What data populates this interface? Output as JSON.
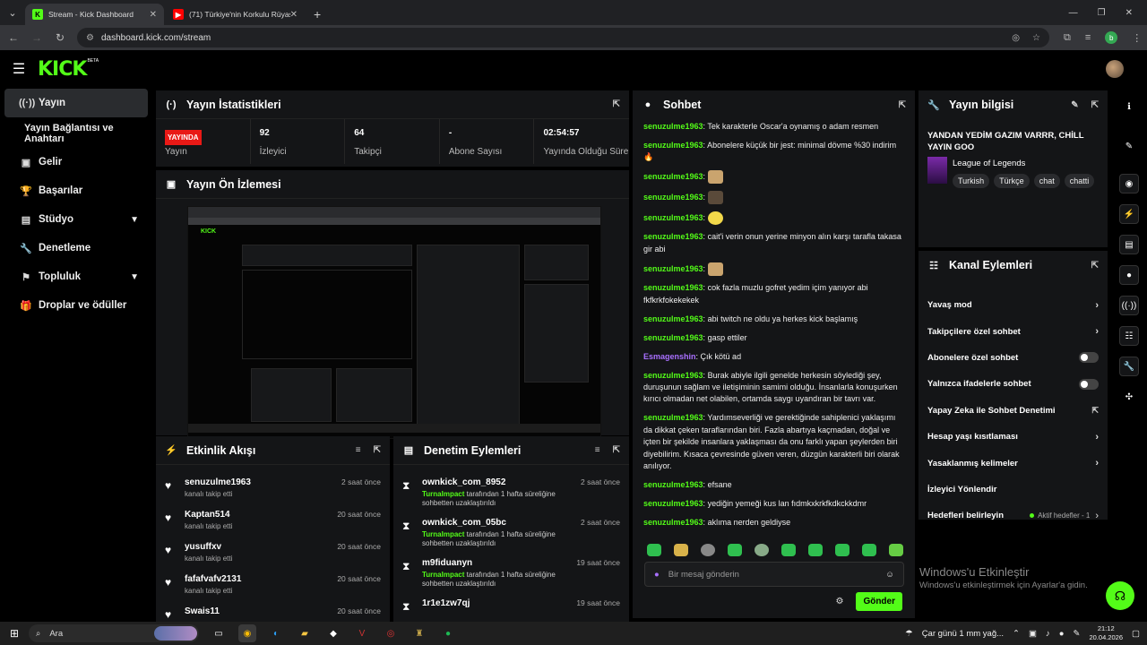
{
  "browser": {
    "tabs": [
      {
        "title": "Stream - Kick Dashboard",
        "active": true
      },
      {
        "title": "(71) Türkiye'nin Korkulu Rüyası",
        "active": false
      }
    ],
    "url": "dashboard.kick.com/stream",
    "profile_initial": "b"
  },
  "header": {
    "logo": "KICK",
    "beta": "BETA"
  },
  "sidebar": {
    "items": [
      {
        "label": "Yayın",
        "icon": "broadcast-icon"
      },
      {
        "label": "Yayın Bağlantısı ve Anahtarı",
        "icon": ""
      },
      {
        "label": "Gelir",
        "icon": "wallet-icon"
      },
      {
        "label": "Başarılar",
        "icon": "trophy-icon"
      },
      {
        "label": "Stüdyo",
        "icon": "studio-icon"
      },
      {
        "label": "Denetleme",
        "icon": "wrench-icon"
      },
      {
        "label": "Topluluk",
        "icon": "community-icon"
      },
      {
        "label": "Droplar ve ödüller",
        "icon": "gift-icon"
      }
    ]
  },
  "stats": {
    "title": "Yayın İstatistikleri",
    "live_badge": "YAYINDA",
    "status_label": "Yayın",
    "viewers": {
      "value": "92",
      "label": "İzleyici"
    },
    "followers": {
      "value": "64",
      "label": "Takipçi"
    },
    "subs": {
      "value": "-",
      "label": "Abone Sayısı"
    },
    "uptime": {
      "value": "02:54:57",
      "label": "Yayında Olduğu Süre"
    }
  },
  "preview": {
    "title": "Yayın Ön İzlemesi"
  },
  "activity": {
    "title": "Etkinlik Akışı",
    "items": [
      {
        "name": "senuzulme1963",
        "sub": "kanalı takip etti",
        "time": "2 saat önce"
      },
      {
        "name": "Kaptan514",
        "sub": "kanalı takip etti",
        "time": "20 saat önce"
      },
      {
        "name": "yusuffxv",
        "sub": "kanalı takip etti",
        "time": "20 saat önce"
      },
      {
        "name": "fafafvafv2131",
        "sub": "kanalı takip etti",
        "time": "20 saat önce"
      },
      {
        "name": "Swais11",
        "sub": "",
        "time": "20 saat önce"
      }
    ]
  },
  "moderation": {
    "title": "Denetim Eylemleri",
    "items": [
      {
        "name": "ownkick_com_8952",
        "by": "TurnaImpact",
        "sub": " tarafından 1 hafta süreliğine sohbetten uzaklaştırıldı",
        "time": "2 saat önce"
      },
      {
        "name": "ownkick_com_05bc",
        "by": "TurnaImpact",
        "sub": " tarafından 1 hafta süreliğine sohbetten uzaklaştırıldı",
        "time": "2 saat önce"
      },
      {
        "name": "m9fiduanyn",
        "by": "TurnaImpact",
        "sub": " tarafından 1 hafta süreliğine sohbetten uzaklaştırıldı",
        "time": "19 saat önce"
      },
      {
        "name": "1r1e1zw7qj",
        "by": "",
        "sub": "",
        "time": "19 saat önce"
      }
    ]
  },
  "chat": {
    "title": "Sohbet",
    "messages": [
      {
        "user": "senuzulme1963",
        "text": "Tek karakterle Oscar'a oynamış o adam resmen"
      },
      {
        "user": "senuzulme1963",
        "text": "Abonelere küçük bir jest: minimal dövme %30 indirim🔥"
      },
      {
        "user": "senuzulme1963",
        "text": "",
        "emote": "emote"
      },
      {
        "user": "senuzulme1963",
        "text": "",
        "emote": "emote b"
      },
      {
        "user": "senuzulme1963",
        "text": "",
        "emote": "emote y"
      },
      {
        "user": "senuzulme1963",
        "text": "cait'i verin onun yerine minyon alın karşı tarafla takasa gir abi"
      },
      {
        "user": "senuzulme1963",
        "text": "",
        "emote": "emote"
      },
      {
        "user": "senuzulme1963",
        "text": "cok fazla muzlu gofret yedim içim yanıyor abi fkfkrkfokekekek"
      },
      {
        "user": "senuzulme1963",
        "text": "abi twitch ne oldu ya herkes kick başlamış"
      },
      {
        "user": "senuzulme1963",
        "text": "gasp ettiler"
      },
      {
        "user": "Esmagenshin",
        "text": "Çık kötü ad",
        "alt": true
      },
      {
        "user": "senuzulme1963",
        "text": "Burak abiyle ilgili genelde herkesin söylediği şey, duruşunun sağlam ve iletişiminin samimi olduğu. İnsanlarla konuşurken kırıcı olmadan net olabilen, ortamda saygı uyandıran bir tavrı var."
      },
      {
        "user": "senuzulme1963",
        "text": "Yardımseverliği ve gerektiğinde sahiplenici yaklaşımı da dikkat çeken taraflarından biri. Fazla abartıya kaçmadan, doğal ve içten bir şekilde insanlara yaklaşması da onu farklı yapan şeylerden biri diyebilirim. Kısaca çevresinde güven veren, düzgün karakterli biri olarak anılıyor."
      },
      {
        "user": "senuzulme1963",
        "text": "efsane"
      },
      {
        "user": "senuzulme1963",
        "text": "yediğin yemeği kus lan fıdmkxkrkfkdkckkdmr"
      },
      {
        "user": "senuzulme1963",
        "text": "aklıma nerden geldiyse"
      }
    ],
    "placeholder": "Bir mesaj gönderin",
    "send_label": "Gönder"
  },
  "info": {
    "title": "Yayın bilgisi",
    "stream_title": "YANDAN YEDİM GAZIM VARRR, CHİLL YAYIN GOO",
    "category": "League of Legends",
    "tags": [
      "Turkish",
      "Türkçe",
      "chat",
      "chatti"
    ]
  },
  "channel_actions": {
    "title": "Kanal Eylemleri",
    "items": [
      {
        "label": "Yavaş mod",
        "kind": "chevron"
      },
      {
        "label": "Takipçilere özel sohbet",
        "kind": "chevron"
      },
      {
        "label": "Abonelere özel sohbet",
        "kind": "toggle"
      },
      {
        "label": "Yalnızca ifadelerle sohbet",
        "kind": "toggle"
      },
      {
        "label": "Yapay Zeka ile Sohbet Denetimi",
        "kind": "external"
      },
      {
        "label": "Hesap yaşı kısıtlaması",
        "kind": "chevron"
      },
      {
        "label": "Yasaklanmış kelimeler",
        "kind": "chevron"
      },
      {
        "label": "İzleyici Yönlendir",
        "kind": "none"
      },
      {
        "label": "Hedefleri belirleyin",
        "kind": "goal",
        "extra": "Aktif hedefler - 1"
      }
    ]
  },
  "watermark": {
    "line1": "Windows'u Etkinleştir",
    "line2": "Windows'u etkinleştirmek için Ayarlar'a gidin."
  },
  "taskbar": {
    "search": "Ara",
    "weather": "Çar günü 1 mm yağ...",
    "time": "21:12",
    "date": "20.04.2026"
  },
  "colors": {
    "accent": "#53fc18",
    "live": "#e91916",
    "alt_user": "#a970ff"
  }
}
